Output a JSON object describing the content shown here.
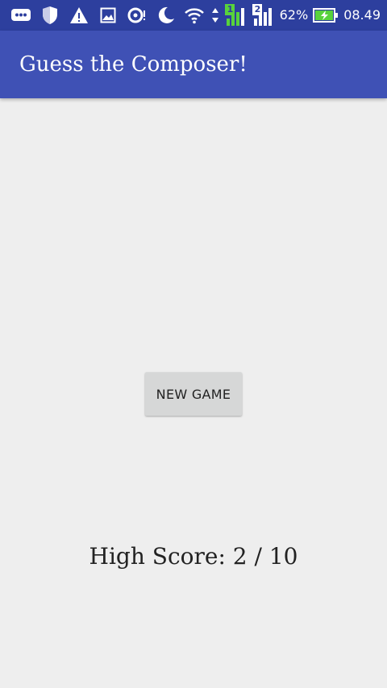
{
  "status_bar": {
    "left_icons": [
      "message-icon",
      "shield-icon",
      "warning-icon",
      "image-icon",
      "sync-alert-icon",
      "moon-icon"
    ],
    "right_icons": [
      "wifi-icon",
      "data-transfer-icon",
      "sim1-signal-icon",
      "sim2-signal-icon",
      "battery-charging-icon"
    ],
    "sim1_label": "1",
    "sim2_label": "2",
    "battery_percent": "62%",
    "time": "08.49"
  },
  "app_bar": {
    "title": "Guess the Composer!",
    "color": "#3f51b5"
  },
  "main": {
    "new_game_label": "NEW GAME",
    "high_score_text": "High Score: 2 / 10"
  },
  "colors": {
    "status_bar": "#2d3f9e",
    "background": "#eeeeee",
    "button": "#d6d7d7",
    "battery_fill": "#58d23c"
  }
}
